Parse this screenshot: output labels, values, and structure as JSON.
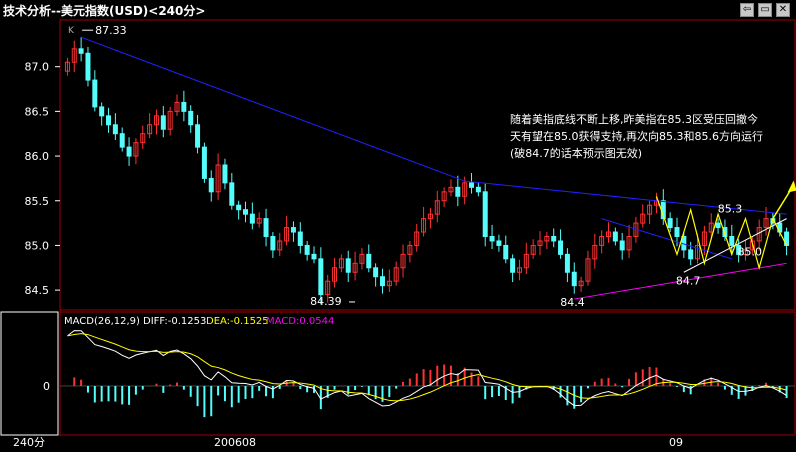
{
  "title": "技术分析--美元指数(USD)<240分>",
  "window_buttons": [
    {
      "name": "back-icon",
      "glyph": "⇦"
    },
    {
      "name": "restore-icon",
      "glyph": "▭"
    },
    {
      "name": "close-icon",
      "glyph": "✕"
    }
  ],
  "colors": {
    "up": "#ff3232",
    "down": "#54fcfc",
    "trend": "#2020ff",
    "pattern": "#ffff00",
    "support": "#ff00ff",
    "axis": "#ffffff",
    "grid": "#a00000"
  },
  "chart_data": [
    {
      "type": "candlestick",
      "title": "",
      "ylim": [
        84.3,
        87.5
      ],
      "y_ticks": [
        84.5,
        85.0,
        85.5,
        86.0,
        86.5,
        87.0
      ],
      "y_tick_labels": [
        "84.5",
        "85.0",
        "85.5",
        "86.0",
        "86.5",
        "87.0"
      ],
      "x_tick_labels": [
        "200608",
        "09"
      ],
      "period_label": "240分",
      "corner_label": "K",
      "closes": [
        87.05,
        87.2,
        87.15,
        86.85,
        86.55,
        86.45,
        86.35,
        86.25,
        86.1,
        86.0,
        86.15,
        86.25,
        86.35,
        86.45,
        86.3,
        86.5,
        86.6,
        86.5,
        86.35,
        86.1,
        85.75,
        85.6,
        85.9,
        85.7,
        85.45,
        85.4,
        85.35,
        85.25,
        85.3,
        85.1,
        84.95,
        85.05,
        85.2,
        85.15,
        85.0,
        84.9,
        84.85,
        84.45,
        84.6,
        84.75,
        84.85,
        84.7,
        84.8,
        84.9,
        84.75,
        84.65,
        84.55,
        84.6,
        84.75,
        84.9,
        85.0,
        85.15,
        85.3,
        85.35,
        85.5,
        85.6,
        85.65,
        85.55,
        85.7,
        85.65,
        85.6,
        85.1,
        85.05,
        85.0,
        84.85,
        84.7,
        84.75,
        84.9,
        85.0,
        85.05,
        85.1,
        85.05,
        84.9,
        84.7,
        84.55,
        84.6,
        84.85,
        85.0,
        85.1,
        85.15,
        85.05,
        84.95,
        85.1,
        85.25,
        85.35,
        85.45,
        85.5,
        85.3,
        85.2,
        85.1,
        84.95,
        84.85,
        85.0,
        85.15,
        85.25,
        85.2,
        85.1,
        85.0,
        84.9,
        84.95,
        85.05,
        85.2,
        85.3,
        85.25,
        85.15,
        85.0
      ],
      "annotations": [
        {
          "text": "87.33",
          "value": 87.33
        },
        {
          "text": "84.39",
          "value": 84.39
        },
        {
          "text": "84.4",
          "value": 84.4
        },
        {
          "text": "84.7",
          "value": 84.7
        },
        {
          "text": "85.3",
          "value": 85.3
        },
        {
          "text": "85.0",
          "value": 85.0
        }
      ],
      "comment": [
        "随着美指底线不断上移,昨美指在85.3区受压回撤今",
        "天有望在85.0获得支持,再次向85.3和85.6方向运行",
        "(破84.7的话本预示图无效)"
      ]
    },
    {
      "type": "macd",
      "header_label": "MACD(26,12,9)",
      "diff_label": "DIFF:-0.1253",
      "dea_label": "DEA:-0.1525",
      "macd_label": "MACD:0.0544",
      "zero_label": "0",
      "diff": -0.1253,
      "dea": -0.1525,
      "macd": 0.0544
    }
  ]
}
